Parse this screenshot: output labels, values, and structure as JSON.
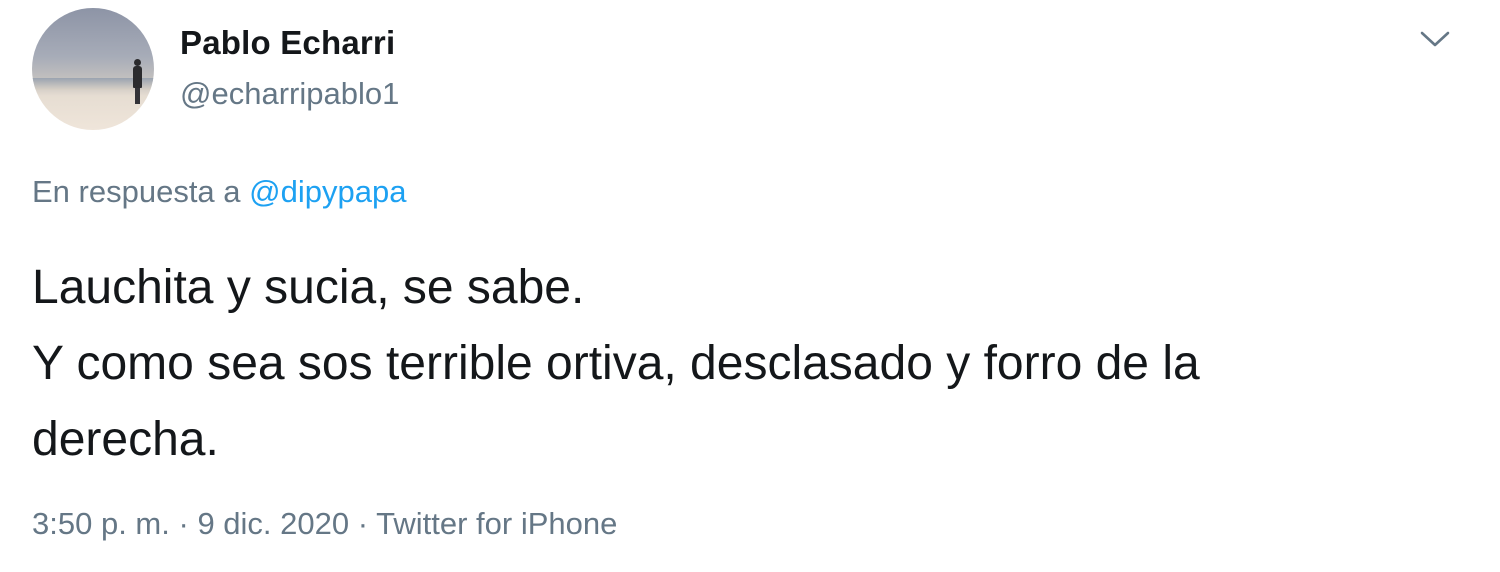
{
  "author": {
    "name": "Pablo Echarri",
    "handle": "@echarripablo1",
    "avatar_icon": "profile-photo-person-on-beach"
  },
  "menu_icon": "chevron-down-icon",
  "reply": {
    "prefix": "En respuesta a",
    "mention": "@dipypapa"
  },
  "tweet": {
    "lines": [
      "Lauchita y sucia, se sabe.",
      "Y como sea sos terrible ortiva, desclasado y forro de la",
      "derecha."
    ]
  },
  "meta": {
    "time": "3:50 p. m.",
    "separator": "·",
    "date": "9 dic. 2020",
    "source": "Twitter for iPhone"
  },
  "colors": {
    "text": "#14171a",
    "secondary": "#657786",
    "link": "#1da1f2",
    "background": "#ffffff"
  }
}
